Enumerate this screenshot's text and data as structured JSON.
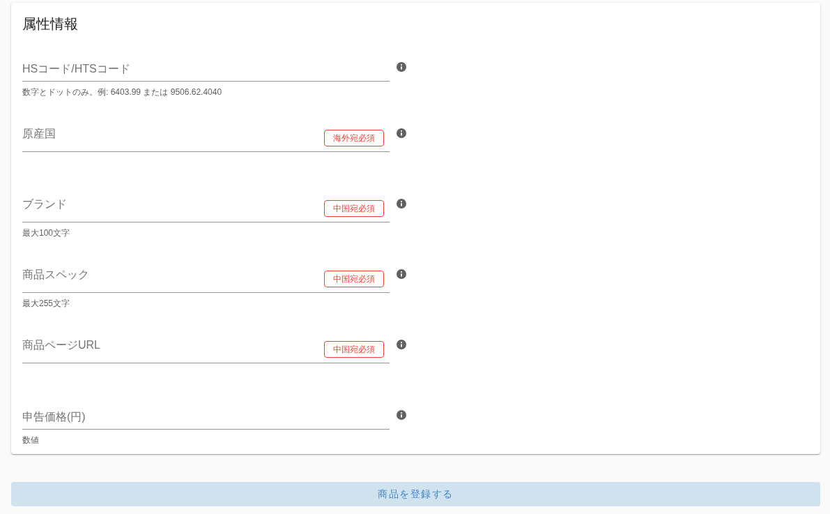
{
  "section": {
    "title": "属性情報"
  },
  "fields": [
    {
      "placeholder": "HSコード/HTSコード",
      "helper": "数字とドットのみ。例: 6403.99 または 9506.62.4040"
    },
    {
      "placeholder": "原産国",
      "badge": "海外宛必須"
    },
    {
      "placeholder": "ブランド",
      "badge": "中国宛必須",
      "helper": "最大100文字"
    },
    {
      "placeholder": "商品スペック",
      "badge": "中国宛必須",
      "helper": "最大255文字"
    },
    {
      "placeholder": "商品ページURL",
      "badge": "中国宛必須"
    },
    {
      "placeholder": "申告価格(円)",
      "helper": "数値"
    }
  ],
  "submit_button": "商品を登録する"
}
